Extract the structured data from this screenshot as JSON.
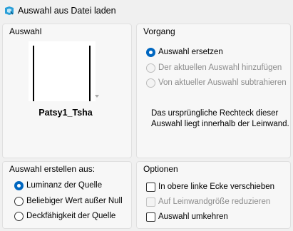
{
  "window": {
    "title": "Auswahl aus Datei laden",
    "icon": "selection-icon"
  },
  "auswahl": {
    "title": "Auswahl",
    "thumbnail_name": "Patsy1_Tsha"
  },
  "vorgang": {
    "title": "Vorgang",
    "options": [
      {
        "label": "Auswahl ersetzen",
        "selected": true,
        "enabled": true
      },
      {
        "label": "Der aktuellen Auswahl hinzufügen",
        "selected": false,
        "enabled": false
      },
      {
        "label": "Von aktueller Auswahl subtrahieren",
        "selected": false,
        "enabled": false
      }
    ],
    "note": "Das ursprüngliche Rechteck dieser Auswahl liegt innerhalb der Leinwand."
  },
  "erstellen": {
    "title": "Auswahl erstellen aus:",
    "options": [
      {
        "label": "Luminanz der Quelle",
        "selected": true
      },
      {
        "label": "Beliebiger Wert außer Null",
        "selected": false
      },
      {
        "label": "Deckfähigkeit der Quelle",
        "selected": false
      }
    ]
  },
  "optionen": {
    "title": "Optionen",
    "items": [
      {
        "label": "In obere linke Ecke verschieben",
        "checked": false,
        "enabled": true
      },
      {
        "label": "Auf Leinwandgröße reduzieren",
        "checked": false,
        "enabled": false
      },
      {
        "label": "Auswahl umkehren",
        "checked": false,
        "enabled": true
      }
    ]
  },
  "colors": {
    "accent": "#0067c0",
    "disabled_text": "#8c8c8c",
    "panel_bg": "#f7f7f7"
  }
}
